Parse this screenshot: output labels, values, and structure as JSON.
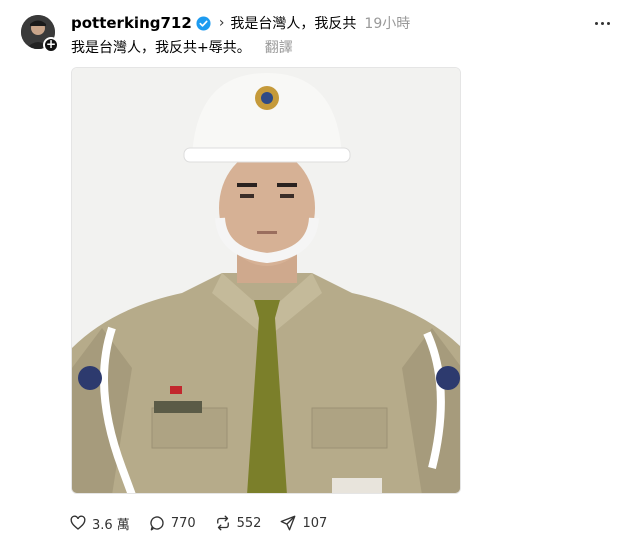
{
  "post": {
    "username": "potterking712",
    "thread_title": "我是台灣人，我反共",
    "timestamp": "19小時",
    "text": "我是台灣人，我反共+辱共。",
    "translate_label": "翻譯"
  },
  "actions": {
    "likes": "3.6 萬",
    "comments": "770",
    "reposts": "552",
    "shares": "107"
  },
  "colors": {
    "verified": "#1d9bf0",
    "secondary_text": "#999999"
  }
}
